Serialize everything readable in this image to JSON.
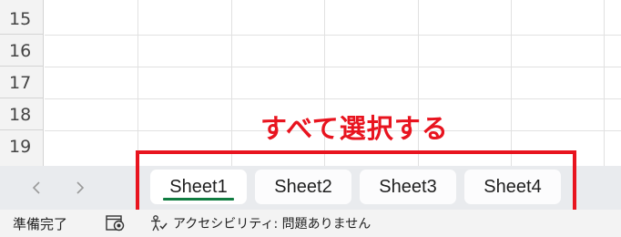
{
  "grid": {
    "rows": [
      "15",
      "16",
      "17",
      "18",
      "19"
    ]
  },
  "sheet_tabs": {
    "prev_icon": "chevron-left-icon",
    "next_icon": "chevron-right-icon",
    "tabs": [
      {
        "label": "Sheet1",
        "active": true
      },
      {
        "label": "Sheet2",
        "active": false
      },
      {
        "label": "Sheet3",
        "active": false
      },
      {
        "label": "Sheet4",
        "active": false
      }
    ],
    "active_underline_color": "#107c41"
  },
  "annotation": {
    "text": "すべて選択する",
    "color": "#e8141f"
  },
  "status_bar": {
    "mode": "準備完了",
    "macro_icon": "macro-record-icon",
    "accessibility_icon": "accessibility-icon",
    "accessibility_text": "アクセシビリティ: 問題ありません"
  }
}
